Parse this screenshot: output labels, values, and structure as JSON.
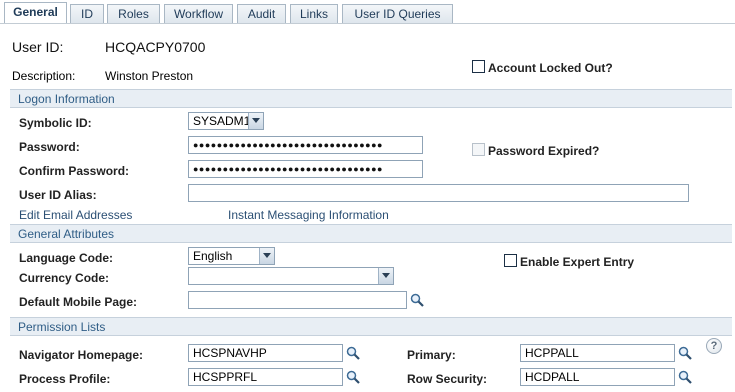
{
  "tabs": [
    {
      "label": "General",
      "active": true
    },
    {
      "label": "ID"
    },
    {
      "label": "Roles"
    },
    {
      "label": "Workflow"
    },
    {
      "label": "Audit"
    },
    {
      "label": "Links"
    },
    {
      "label": "User ID Queries"
    }
  ],
  "header": {
    "user_id_label": "User ID:",
    "user_id_value": "HCQACPY0700",
    "description_label": "Description:",
    "description_value": "Winston Preston",
    "account_locked_label": "Account Locked Out?"
  },
  "logon": {
    "section_title": "Logon Information",
    "symbolic_id_label": "Symbolic ID:",
    "symbolic_id_value": "SYSADM1",
    "password_label": "Password:",
    "password_value": "●●●●●●●●●●●●●●●●●●●●●●●●●●●●●●●●",
    "confirm_password_label": "Confirm Password:",
    "confirm_password_value": "●●●●●●●●●●●●●●●●●●●●●●●●●●●●●●●●",
    "password_expired_label": "Password Expired?",
    "alias_label": "User ID Alias:",
    "alias_value": "",
    "edit_email_link": "Edit Email Addresses",
    "instant_messaging_link": "Instant Messaging Information"
  },
  "general": {
    "section_title": "General Attributes",
    "language_label": "Language Code:",
    "language_value": "English",
    "currency_label": "Currency Code:",
    "currency_value": "",
    "expert_entry_label": "Enable Expert Entry",
    "mobile_label": "Default Mobile Page:",
    "mobile_value": ""
  },
  "permissions": {
    "section_title": "Permission Lists",
    "nav_home_label": "Navigator Homepage:",
    "nav_home_value": "HCSPNAVHP",
    "process_label": "Process Profile:",
    "process_value": "HCSPPRFL",
    "primary_label": "Primary:",
    "primary_value": "HCPPALL",
    "row_security_label": "Row Security:",
    "row_security_value": "HCDPALL",
    "help_glyph": "?"
  }
}
